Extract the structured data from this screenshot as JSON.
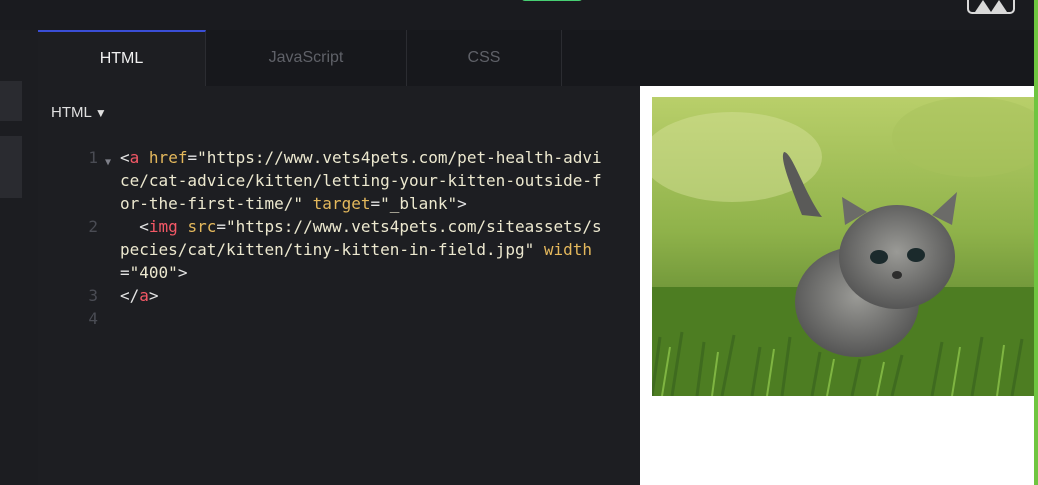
{
  "tabs": [
    {
      "label": "HTML",
      "active": true
    },
    {
      "label": "JavaScript",
      "active": false
    },
    {
      "label": "CSS",
      "active": false
    }
  ],
  "editor": {
    "language_label": "HTML",
    "dropdown_icon": "caret-down-icon",
    "lines": [
      {
        "number": "1",
        "foldable": true,
        "segments": [
          {
            "t": "<",
            "c": "txt"
          },
          {
            "t": "a",
            "c": "tag"
          },
          {
            "t": " ",
            "c": "txt"
          },
          {
            "t": "href",
            "c": "attr"
          },
          {
            "t": "=",
            "c": "txt"
          },
          {
            "t": "\"https://www.vets4pets.com/pet-health-advi",
            "c": "str"
          }
        ]
      },
      {
        "number": "",
        "segments": [
          {
            "t": "ce/cat-advice/kitten/letting-your-kitten-outside-f",
            "c": "str"
          }
        ]
      },
      {
        "number": "",
        "segments": [
          {
            "t": "or-the-first-time/\"",
            "c": "str"
          },
          {
            "t": " ",
            "c": "txt"
          },
          {
            "t": "target",
            "c": "attr"
          },
          {
            "t": "=",
            "c": "txt"
          },
          {
            "t": "\"_blank\"",
            "c": "str"
          },
          {
            "t": ">",
            "c": "txt"
          }
        ]
      },
      {
        "number": "2",
        "segments": [
          {
            "t": "  <",
            "c": "txt"
          },
          {
            "t": "img",
            "c": "tag"
          },
          {
            "t": " ",
            "c": "txt"
          },
          {
            "t": "src",
            "c": "attr"
          },
          {
            "t": "=",
            "c": "txt"
          },
          {
            "t": "\"https://www.vets4pets.com/siteassets/s",
            "c": "str"
          }
        ]
      },
      {
        "number": "",
        "segments": [
          {
            "t": "pecies/cat/kitten/tiny-kitten-in-field.jpg\"",
            "c": "str"
          },
          {
            "t": " ",
            "c": "txt"
          },
          {
            "t": "width",
            "c": "attr"
          }
        ]
      },
      {
        "number": "",
        "segments": [
          {
            "t": "=",
            "c": "txt"
          },
          {
            "t": "\"400\"",
            "c": "str"
          },
          {
            "t": ">",
            "c": "txt"
          }
        ]
      },
      {
        "number": "3",
        "segments": [
          {
            "t": "</",
            "c": "txt"
          },
          {
            "t": "a",
            "c": "tag"
          },
          {
            "t": ">",
            "c": "txt"
          }
        ]
      },
      {
        "number": "4",
        "segments": []
      }
    ]
  },
  "preview": {
    "image_icon": "kitten-photo"
  },
  "colors": {
    "tag": "#f45866",
    "attr": "#e4b85c",
    "str": "#ece8cf",
    "txt": "#e4e4e4",
    "active_tab_accent": "#3a4ed6",
    "run_button": "#47cf73"
  }
}
